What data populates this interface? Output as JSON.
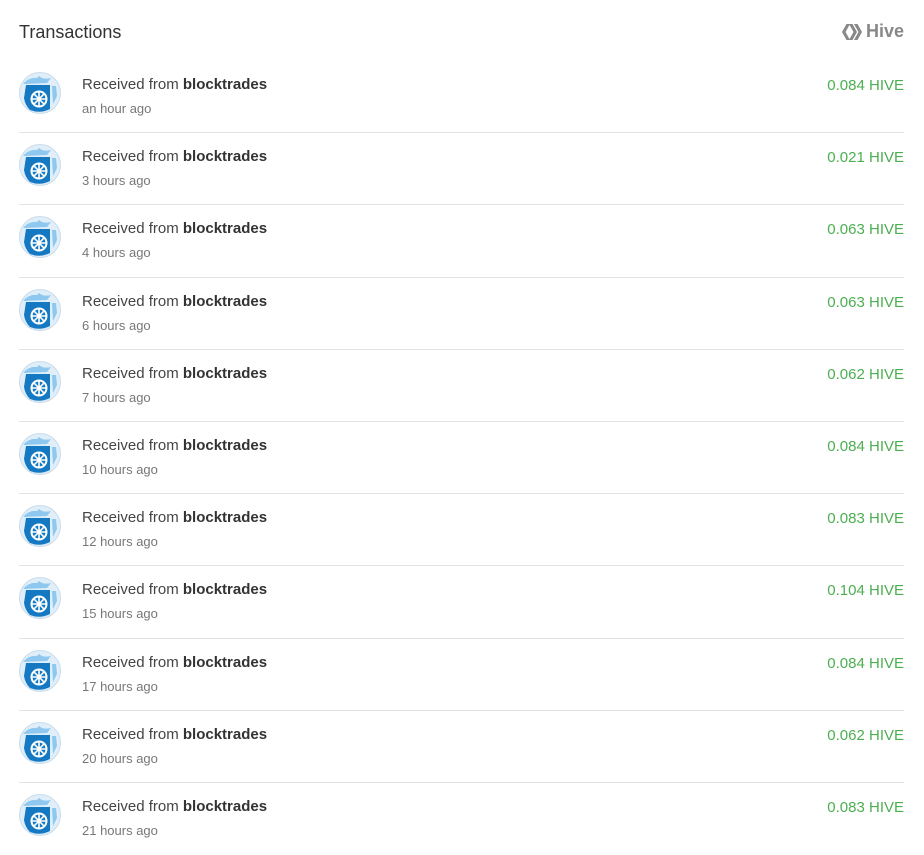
{
  "header": {
    "title": "Transactions",
    "brand": "Hive",
    "brand_icon": "hive-logo-icon"
  },
  "colors": {
    "amount": "#4caf50",
    "divider": "#e3e3e3",
    "brand": "#888888",
    "avatar_blue": "#1479c2"
  },
  "transactions": [
    {
      "prefix": "Received from",
      "counterparty": "blocktrades",
      "time": "an hour ago",
      "amount": "0.084 HIVE",
      "avatar_icon": "blocktrades-avatar-icon"
    },
    {
      "prefix": "Received from",
      "counterparty": "blocktrades",
      "time": "3 hours ago",
      "amount": "0.021 HIVE",
      "avatar_icon": "blocktrades-avatar-icon"
    },
    {
      "prefix": "Received from",
      "counterparty": "blocktrades",
      "time": "4 hours ago",
      "amount": "0.063 HIVE",
      "avatar_icon": "blocktrades-avatar-icon"
    },
    {
      "prefix": "Received from",
      "counterparty": "blocktrades",
      "time": "6 hours ago",
      "amount": "0.063 HIVE",
      "avatar_icon": "blocktrades-avatar-icon"
    },
    {
      "prefix": "Received from",
      "counterparty": "blocktrades",
      "time": "7 hours ago",
      "amount": "0.062 HIVE",
      "avatar_icon": "blocktrades-avatar-icon"
    },
    {
      "prefix": "Received from",
      "counterparty": "blocktrades",
      "time": "10 hours ago",
      "amount": "0.084 HIVE",
      "avatar_icon": "blocktrades-avatar-icon"
    },
    {
      "prefix": "Received from",
      "counterparty": "blocktrades",
      "time": "12 hours ago",
      "amount": "0.083 HIVE",
      "avatar_icon": "blocktrades-avatar-icon"
    },
    {
      "prefix": "Received from",
      "counterparty": "blocktrades",
      "time": "15 hours ago",
      "amount": "0.104 HIVE",
      "avatar_icon": "blocktrades-avatar-icon"
    },
    {
      "prefix": "Received from",
      "counterparty": "blocktrades",
      "time": "17 hours ago",
      "amount": "0.084 HIVE",
      "avatar_icon": "blocktrades-avatar-icon"
    },
    {
      "prefix": "Received from",
      "counterparty": "blocktrades",
      "time": "20 hours ago",
      "amount": "0.062 HIVE",
      "avatar_icon": "blocktrades-avatar-icon"
    },
    {
      "prefix": "Received from",
      "counterparty": "blocktrades",
      "time": "21 hours ago",
      "amount": "0.083 HIVE",
      "avatar_icon": "blocktrades-avatar-icon"
    }
  ]
}
